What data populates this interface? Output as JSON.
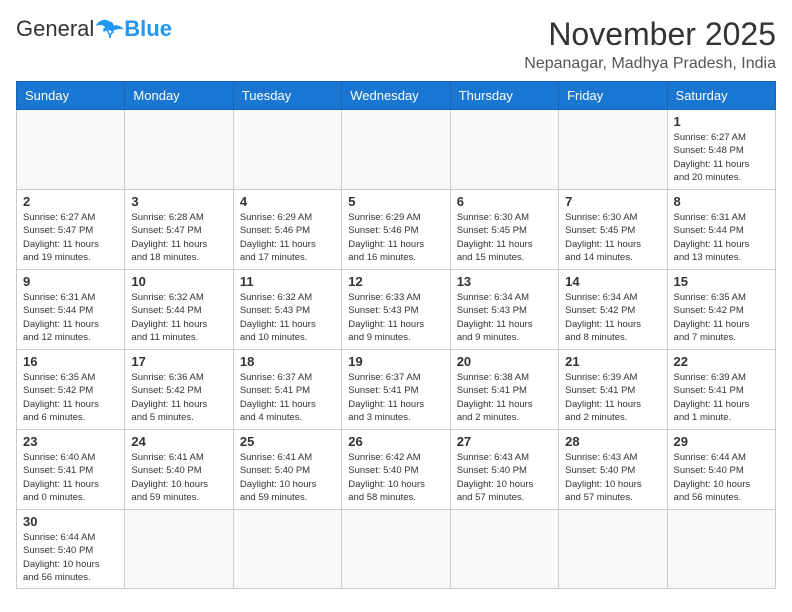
{
  "header": {
    "logo_general": "General",
    "logo_blue": "Blue",
    "month_title": "November 2025",
    "location": "Nepanagar, Madhya Pradesh, India"
  },
  "days_of_week": [
    "Sunday",
    "Monday",
    "Tuesday",
    "Wednesday",
    "Thursday",
    "Friday",
    "Saturday"
  ],
  "weeks": [
    [
      {
        "day": "",
        "info": ""
      },
      {
        "day": "",
        "info": ""
      },
      {
        "day": "",
        "info": ""
      },
      {
        "day": "",
        "info": ""
      },
      {
        "day": "",
        "info": ""
      },
      {
        "day": "",
        "info": ""
      },
      {
        "day": "1",
        "info": "Sunrise: 6:27 AM\nSunset: 5:48 PM\nDaylight: 11 hours\nand 20 minutes."
      }
    ],
    [
      {
        "day": "2",
        "info": "Sunrise: 6:27 AM\nSunset: 5:47 PM\nDaylight: 11 hours\nand 19 minutes."
      },
      {
        "day": "3",
        "info": "Sunrise: 6:28 AM\nSunset: 5:47 PM\nDaylight: 11 hours\nand 18 minutes."
      },
      {
        "day": "4",
        "info": "Sunrise: 6:29 AM\nSunset: 5:46 PM\nDaylight: 11 hours\nand 17 minutes."
      },
      {
        "day": "5",
        "info": "Sunrise: 6:29 AM\nSunset: 5:46 PM\nDaylight: 11 hours\nand 16 minutes."
      },
      {
        "day": "6",
        "info": "Sunrise: 6:30 AM\nSunset: 5:45 PM\nDaylight: 11 hours\nand 15 minutes."
      },
      {
        "day": "7",
        "info": "Sunrise: 6:30 AM\nSunset: 5:45 PM\nDaylight: 11 hours\nand 14 minutes."
      },
      {
        "day": "8",
        "info": "Sunrise: 6:31 AM\nSunset: 5:44 PM\nDaylight: 11 hours\nand 13 minutes."
      }
    ],
    [
      {
        "day": "9",
        "info": "Sunrise: 6:31 AM\nSunset: 5:44 PM\nDaylight: 11 hours\nand 12 minutes."
      },
      {
        "day": "10",
        "info": "Sunrise: 6:32 AM\nSunset: 5:44 PM\nDaylight: 11 hours\nand 11 minutes."
      },
      {
        "day": "11",
        "info": "Sunrise: 6:32 AM\nSunset: 5:43 PM\nDaylight: 11 hours\nand 10 minutes."
      },
      {
        "day": "12",
        "info": "Sunrise: 6:33 AM\nSunset: 5:43 PM\nDaylight: 11 hours\nand 9 minutes."
      },
      {
        "day": "13",
        "info": "Sunrise: 6:34 AM\nSunset: 5:43 PM\nDaylight: 11 hours\nand 9 minutes."
      },
      {
        "day": "14",
        "info": "Sunrise: 6:34 AM\nSunset: 5:42 PM\nDaylight: 11 hours\nand 8 minutes."
      },
      {
        "day": "15",
        "info": "Sunrise: 6:35 AM\nSunset: 5:42 PM\nDaylight: 11 hours\nand 7 minutes."
      }
    ],
    [
      {
        "day": "16",
        "info": "Sunrise: 6:35 AM\nSunset: 5:42 PM\nDaylight: 11 hours\nand 6 minutes."
      },
      {
        "day": "17",
        "info": "Sunrise: 6:36 AM\nSunset: 5:42 PM\nDaylight: 11 hours\nand 5 minutes."
      },
      {
        "day": "18",
        "info": "Sunrise: 6:37 AM\nSunset: 5:41 PM\nDaylight: 11 hours\nand 4 minutes."
      },
      {
        "day": "19",
        "info": "Sunrise: 6:37 AM\nSunset: 5:41 PM\nDaylight: 11 hours\nand 3 minutes."
      },
      {
        "day": "20",
        "info": "Sunrise: 6:38 AM\nSunset: 5:41 PM\nDaylight: 11 hours\nand 2 minutes."
      },
      {
        "day": "21",
        "info": "Sunrise: 6:39 AM\nSunset: 5:41 PM\nDaylight: 11 hours\nand 2 minutes."
      },
      {
        "day": "22",
        "info": "Sunrise: 6:39 AM\nSunset: 5:41 PM\nDaylight: 11 hours\nand 1 minute."
      }
    ],
    [
      {
        "day": "23",
        "info": "Sunrise: 6:40 AM\nSunset: 5:41 PM\nDaylight: 11 hours\nand 0 minutes."
      },
      {
        "day": "24",
        "info": "Sunrise: 6:41 AM\nSunset: 5:40 PM\nDaylight: 10 hours\nand 59 minutes."
      },
      {
        "day": "25",
        "info": "Sunrise: 6:41 AM\nSunset: 5:40 PM\nDaylight: 10 hours\nand 59 minutes."
      },
      {
        "day": "26",
        "info": "Sunrise: 6:42 AM\nSunset: 5:40 PM\nDaylight: 10 hours\nand 58 minutes."
      },
      {
        "day": "27",
        "info": "Sunrise: 6:43 AM\nSunset: 5:40 PM\nDaylight: 10 hours\nand 57 minutes."
      },
      {
        "day": "28",
        "info": "Sunrise: 6:43 AM\nSunset: 5:40 PM\nDaylight: 10 hours\nand 57 minutes."
      },
      {
        "day": "29",
        "info": "Sunrise: 6:44 AM\nSunset: 5:40 PM\nDaylight: 10 hours\nand 56 minutes."
      }
    ],
    [
      {
        "day": "30",
        "info": "Sunrise: 6:44 AM\nSunset: 5:40 PM\nDaylight: 10 hours\nand 56 minutes."
      },
      {
        "day": "",
        "info": ""
      },
      {
        "day": "",
        "info": ""
      },
      {
        "day": "",
        "info": ""
      },
      {
        "day": "",
        "info": ""
      },
      {
        "day": "",
        "info": ""
      },
      {
        "day": "",
        "info": ""
      }
    ]
  ]
}
